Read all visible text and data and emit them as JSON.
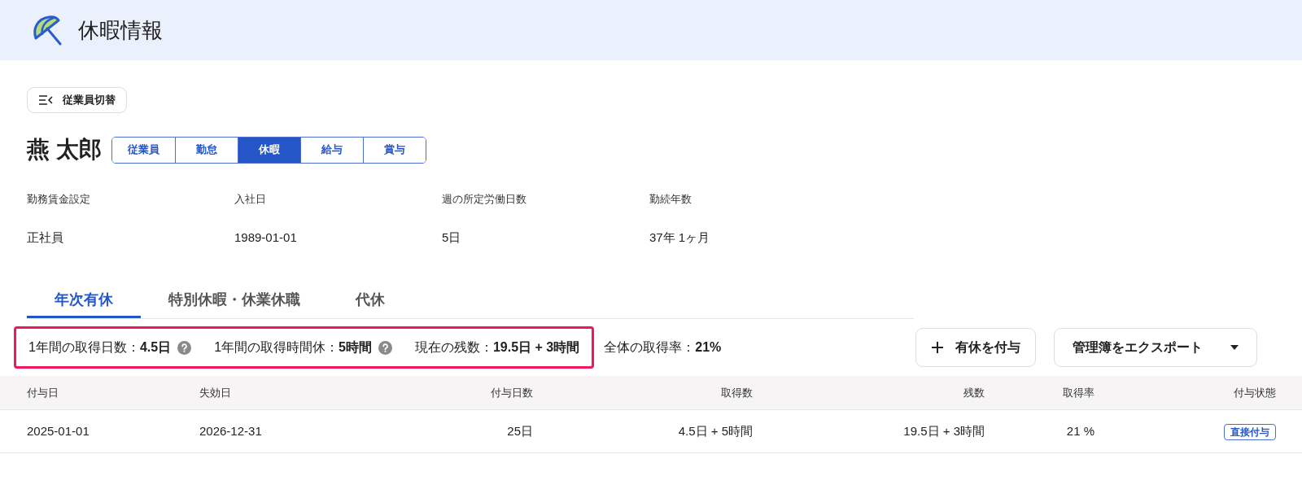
{
  "header": {
    "title": "休暇情報"
  },
  "switch_button": {
    "label": "従業員切替"
  },
  "employee": {
    "name": "燕 太郎"
  },
  "section_tabs": [
    {
      "label": "従業員",
      "selected": false
    },
    {
      "label": "勤怠",
      "selected": false
    },
    {
      "label": "休暇",
      "selected": true
    },
    {
      "label": "給与",
      "selected": false
    },
    {
      "label": "賞与",
      "selected": false
    }
  ],
  "info": [
    {
      "label": "勤務賃金設定",
      "value": "正社員"
    },
    {
      "label": "入社日",
      "value": "1989-01-01"
    },
    {
      "label": "週の所定労働日数",
      "value": "5日"
    },
    {
      "label": "勤続年数",
      "value": "37年 1ヶ月"
    }
  ],
  "leave_tabs": [
    {
      "label": "年次有休",
      "selected": true
    },
    {
      "label": "特別休暇・休業休職",
      "selected": false
    },
    {
      "label": "代休",
      "selected": false
    }
  ],
  "highlighted_stats": [
    {
      "text": "1年間の取得日数：**4.5日**",
      "help": true
    },
    {
      "text": "1年間の取得時間休：**5時間**",
      "help": true
    },
    {
      "text": "現在の残数：**19.5日 + 3時間**",
      "help": false
    }
  ],
  "stats": [
    {
      "text": "全体の取得率：**21%**",
      "help": false
    }
  ],
  "grant_button": {
    "label": "有休を付与"
  },
  "export_button": {
    "label": "管理簿をエクスポート"
  },
  "table": {
    "columns": [
      "付与日",
      "失効日",
      "付与日数",
      "取得数",
      "残数",
      "取得率",
      "付与状態"
    ],
    "rows": [
      {
        "cells": [
          "2025-01-01",
          "2026-12-31",
          "25日",
          "4.5日 + 5時間",
          "19.5日 + 3時間",
          "21 %"
        ],
        "status": "直接付与"
      }
    ]
  }
}
